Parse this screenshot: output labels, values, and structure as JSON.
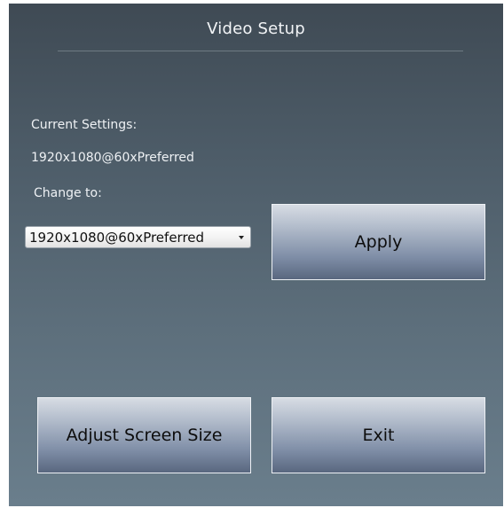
{
  "window": {
    "title": "Video Setup"
  },
  "current_settings": {
    "label": "Current Settings:",
    "value": "1920x1080@60xPreferred"
  },
  "change_to": {
    "label": "Change to:",
    "selected": "1920x1080@60xPreferred"
  },
  "buttons": {
    "apply": "Apply",
    "adjust_screen_size": "Adjust Screen Size",
    "exit": "Exit"
  },
  "icons": {
    "dropdown": "chevron-down-icon"
  },
  "colors": {
    "background_top": "#3f4a54",
    "background_bottom": "#6a7e8c",
    "text": "#eef1f4"
  }
}
